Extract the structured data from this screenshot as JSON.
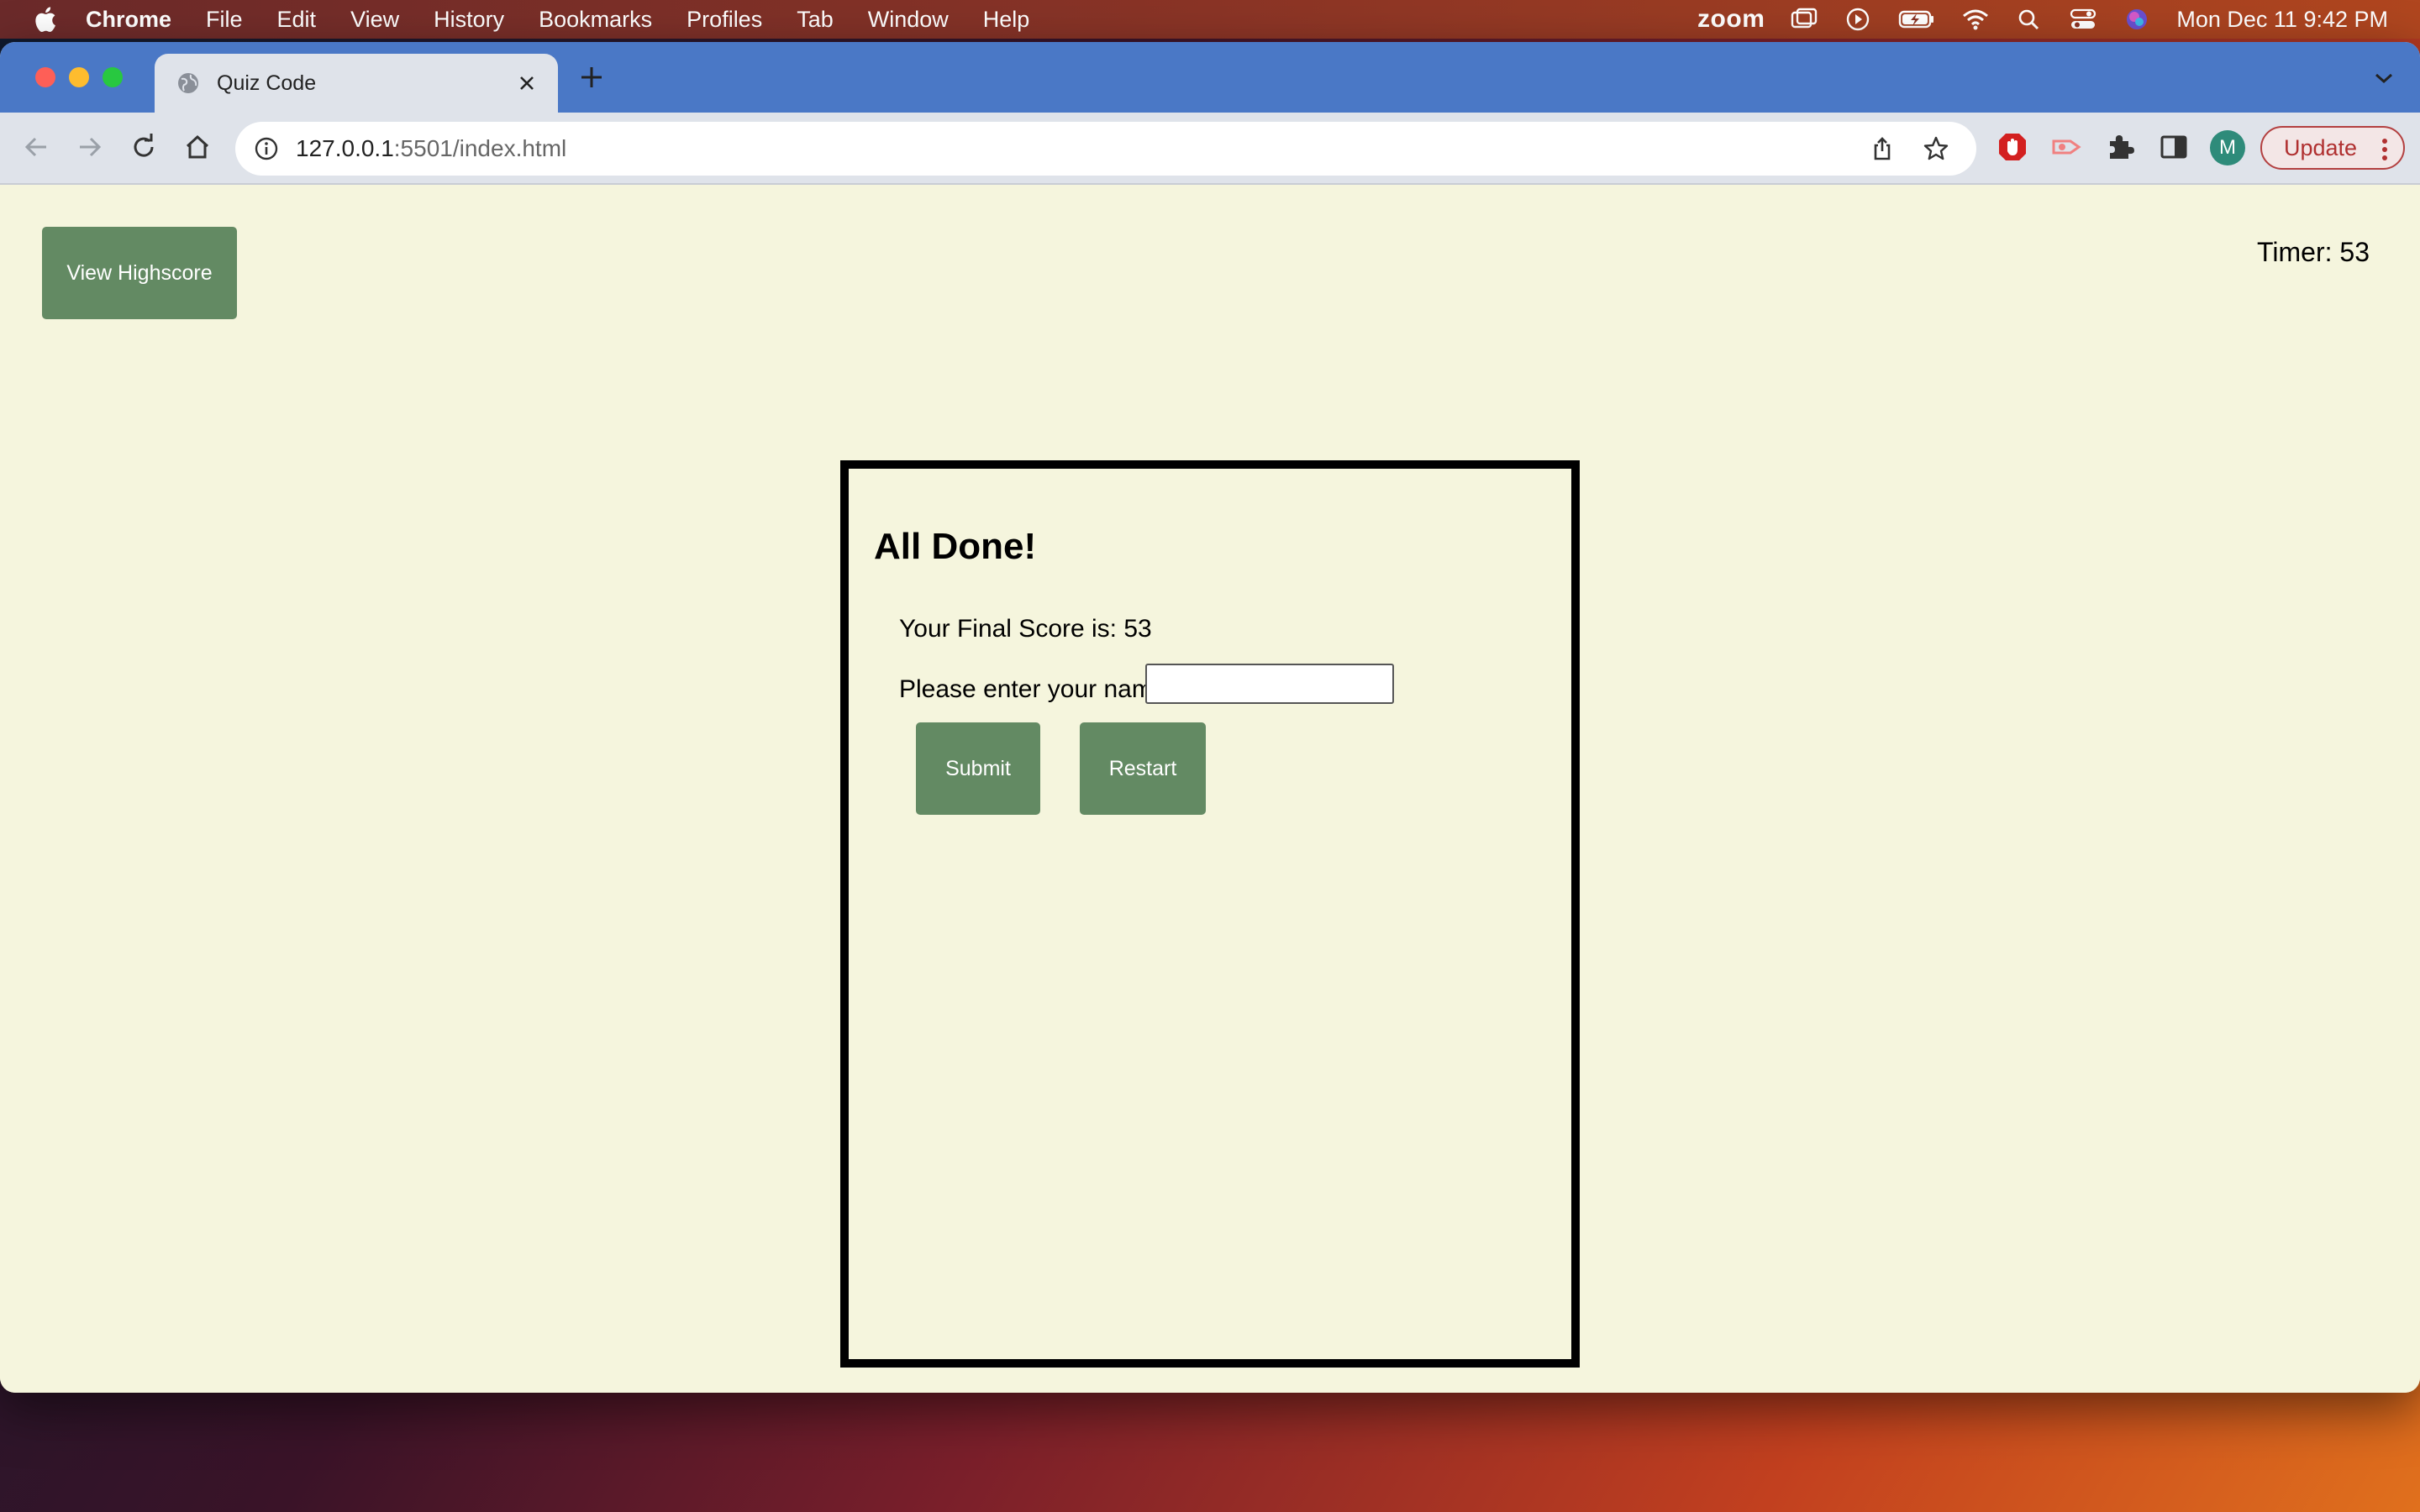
{
  "menubar": {
    "app": "Chrome",
    "items": [
      "File",
      "Edit",
      "View",
      "History",
      "Bookmarks",
      "Profiles",
      "Tab",
      "Window",
      "Help"
    ],
    "zoom_label": "zoom",
    "clock": "Mon Dec 11  9:42 PM"
  },
  "browser": {
    "tab_title": "Quiz Code",
    "url_host": "127.0.0.1",
    "url_rest": ":5501/index.html",
    "avatar_letter": "M",
    "update_label": "Update"
  },
  "page": {
    "highscore_label": "View Highscore",
    "timer": "Timer: 53",
    "title": "All Done!",
    "score_line": "Your Final Score is: 53",
    "name_label": "Please enter your name:",
    "name_value": "",
    "submit_label": "Submit",
    "restart_label": "Restart"
  },
  "colors": {
    "page_bg": "#f5f5dd",
    "button_green": "#638a63",
    "tab_strip": "#4a78c6"
  },
  "icons": [
    "apple-icon",
    "screen-share-icon",
    "play-icon",
    "battery-icon",
    "wifi-icon",
    "search-icon",
    "control-center-icon",
    "siri-icon",
    "globe-icon",
    "close-icon",
    "plus-icon",
    "chevron-down-icon",
    "back-arrow-icon",
    "forward-arrow-icon",
    "reload-icon",
    "home-icon",
    "info-icon",
    "share-icon",
    "star-icon",
    "adblock-icon",
    "extension-puzzle-icon",
    "sidepanel-icon",
    "kebab-menu-icon"
  ]
}
